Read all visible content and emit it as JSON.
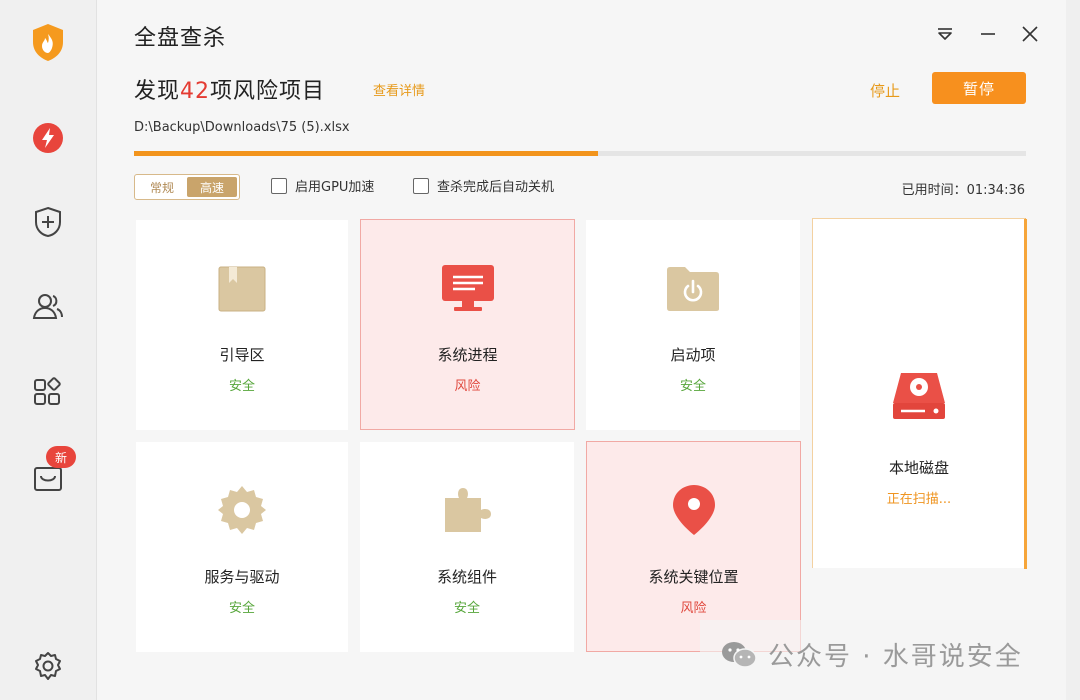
{
  "sidebar": {
    "items": [
      {
        "name": "home",
        "icon": "shield-flame-icon"
      },
      {
        "name": "speedup",
        "icon": "lightning-icon"
      },
      {
        "name": "repair",
        "icon": "shield-plus-icon"
      },
      {
        "name": "users",
        "icon": "users-icon"
      },
      {
        "name": "apps",
        "icon": "apps-grid-icon"
      },
      {
        "name": "new-feature",
        "icon": "toolbox-icon",
        "badge": "新"
      },
      {
        "name": "settings",
        "icon": "gear-icon"
      }
    ]
  },
  "window": {
    "title": "全盘查杀",
    "controls": [
      "menu-icon",
      "minimize-icon",
      "close-icon"
    ]
  },
  "scan": {
    "headline_prefix": "发现",
    "risk_count": "42",
    "headline_suffix": "项风险项目",
    "details_link": "查看详情",
    "stop_label": "停止",
    "pause_label": "暂停",
    "current_file": "D:\\Backup\\Downloads\\75 (5).xlsx",
    "progress": 0.52,
    "mode_normal": "常规",
    "mode_fast": "高速",
    "gpu_label": "启用GPU加速",
    "shutdown_label": "查杀完成后自动关机",
    "elapsed_label": "已用时间：",
    "elapsed_value": "01:34:36"
  },
  "categories": [
    {
      "name": "引导区",
      "status": "安全",
      "state": "safe",
      "icon": "book-icon"
    },
    {
      "name": "系统进程",
      "status": "风险",
      "state": "risk",
      "icon": "monitor-icon"
    },
    {
      "name": "启动项",
      "status": "安全",
      "state": "safe",
      "icon": "power-folder-icon"
    },
    {
      "name": "服务与驱动",
      "status": "安全",
      "state": "safe",
      "icon": "gear-icon"
    },
    {
      "name": "系统组件",
      "status": "安全",
      "state": "safe",
      "icon": "puzzle-icon"
    },
    {
      "name": "系统关键位置",
      "status": "风险",
      "state": "risk",
      "icon": "location-pin-icon"
    },
    {
      "name": "本地磁盘",
      "status": "正在扫描...",
      "state": "scanning",
      "icon": "hard-disk-icon"
    }
  ],
  "watermark": {
    "text": "公众号 · 水哥说安全",
    "icon": "wechat-icon"
  },
  "colors": {
    "accent": "#f7901e",
    "risk": "#e0493f",
    "safe": "#57a63b",
    "tile_gold": "#d8c39c"
  }
}
